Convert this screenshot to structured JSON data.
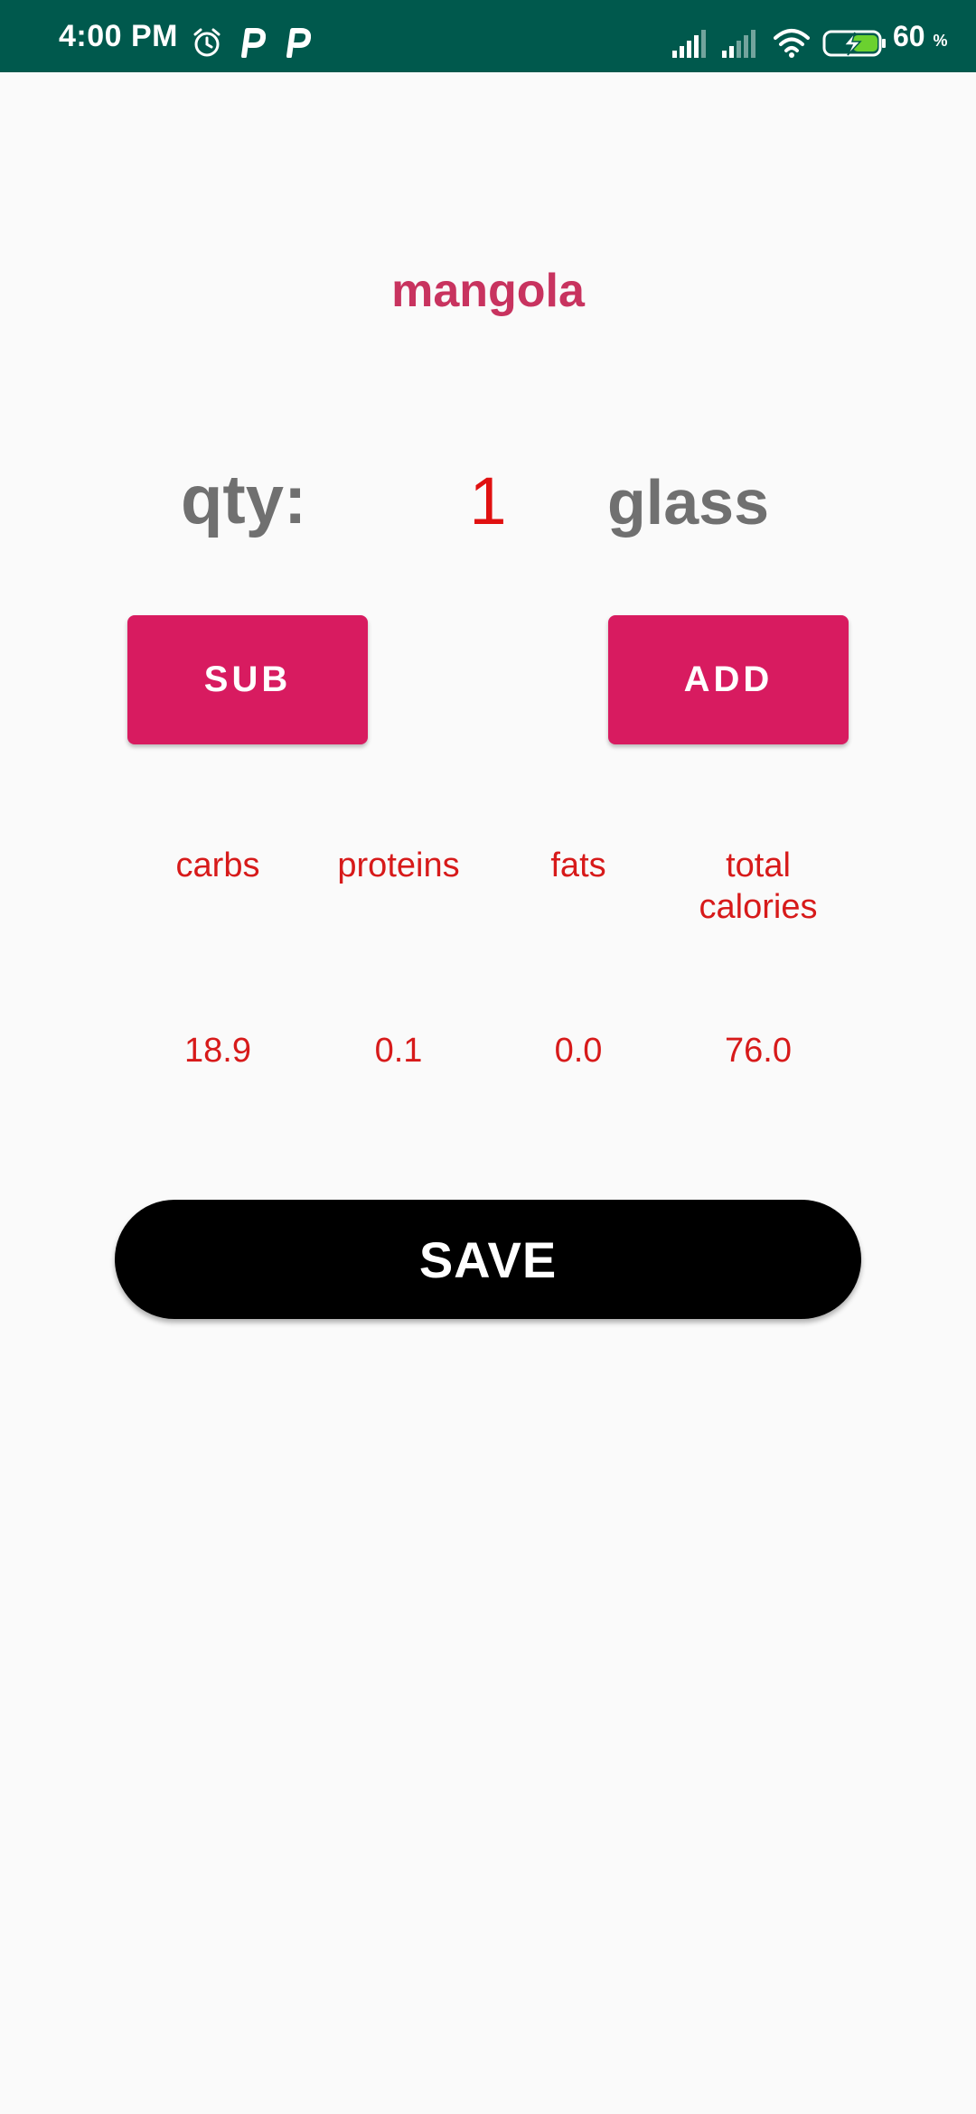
{
  "status_bar": {
    "time": "4:00 PM",
    "battery_level": "60",
    "battery_unit": "%",
    "icons": [
      "alarm-icon",
      "parking-icon",
      "parking-icon",
      "signal-icon",
      "signal-icon",
      "wifi-icon",
      "battery-charging-icon"
    ]
  },
  "food": {
    "name": "mangola"
  },
  "quantity": {
    "label": "qty:",
    "value": "1",
    "unit": "glass"
  },
  "buttons": {
    "sub_label": "SUB",
    "add_label": "ADD",
    "save_label": "SAVE"
  },
  "nutrients": {
    "labels": [
      "carbs",
      "proteins",
      "fats",
      "total calories"
    ],
    "values": [
      "18.9",
      "0.1",
      "0.0",
      "76.0"
    ]
  },
  "colors": {
    "status_bar": "#00594d",
    "food_name": "#c8335f",
    "accent_button": "#d81b60",
    "nutrient_text": "#d71a1a",
    "save_button": "#000000"
  }
}
